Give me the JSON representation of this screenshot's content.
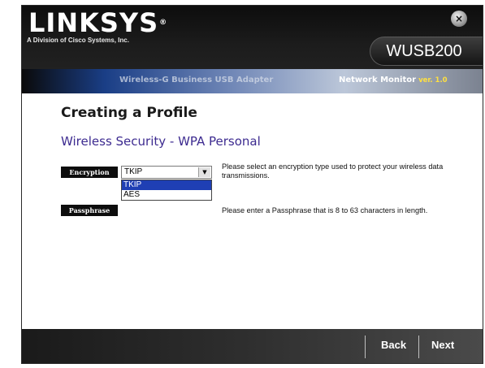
{
  "header": {
    "brand": "LINKSYS",
    "brand_mark": "®",
    "tagline": "A Division of Cisco Systems, Inc.",
    "model": "WUSB200",
    "product": "Wireless-G Business USB Adapter",
    "monitor": "Network Monitor",
    "version": "ver. 1.0",
    "close_symbol": "×"
  },
  "main": {
    "title": "Creating a Profile",
    "section": "Wireless Security - WPA Personal",
    "encryption": {
      "label": "Encryption",
      "value": "TKIP",
      "options": [
        "TKIP",
        "AES"
      ],
      "highlighted_option": "TKIP",
      "help": "Please select an encryption type used to protect your wireless data transmissions."
    },
    "passphrase": {
      "label": "Passphrase",
      "help": "Please enter a Passphrase that is 8 to 63 characters in length."
    }
  },
  "footer": {
    "back_label": "Back",
    "next_label": "Next"
  },
  "colors": {
    "section_title": "#3d2b90",
    "selected_option": "#1f3fb4",
    "version_accent": "#ffe040"
  },
  "icons": {
    "close": "close-icon",
    "dropdown": "chevron-down-icon"
  }
}
